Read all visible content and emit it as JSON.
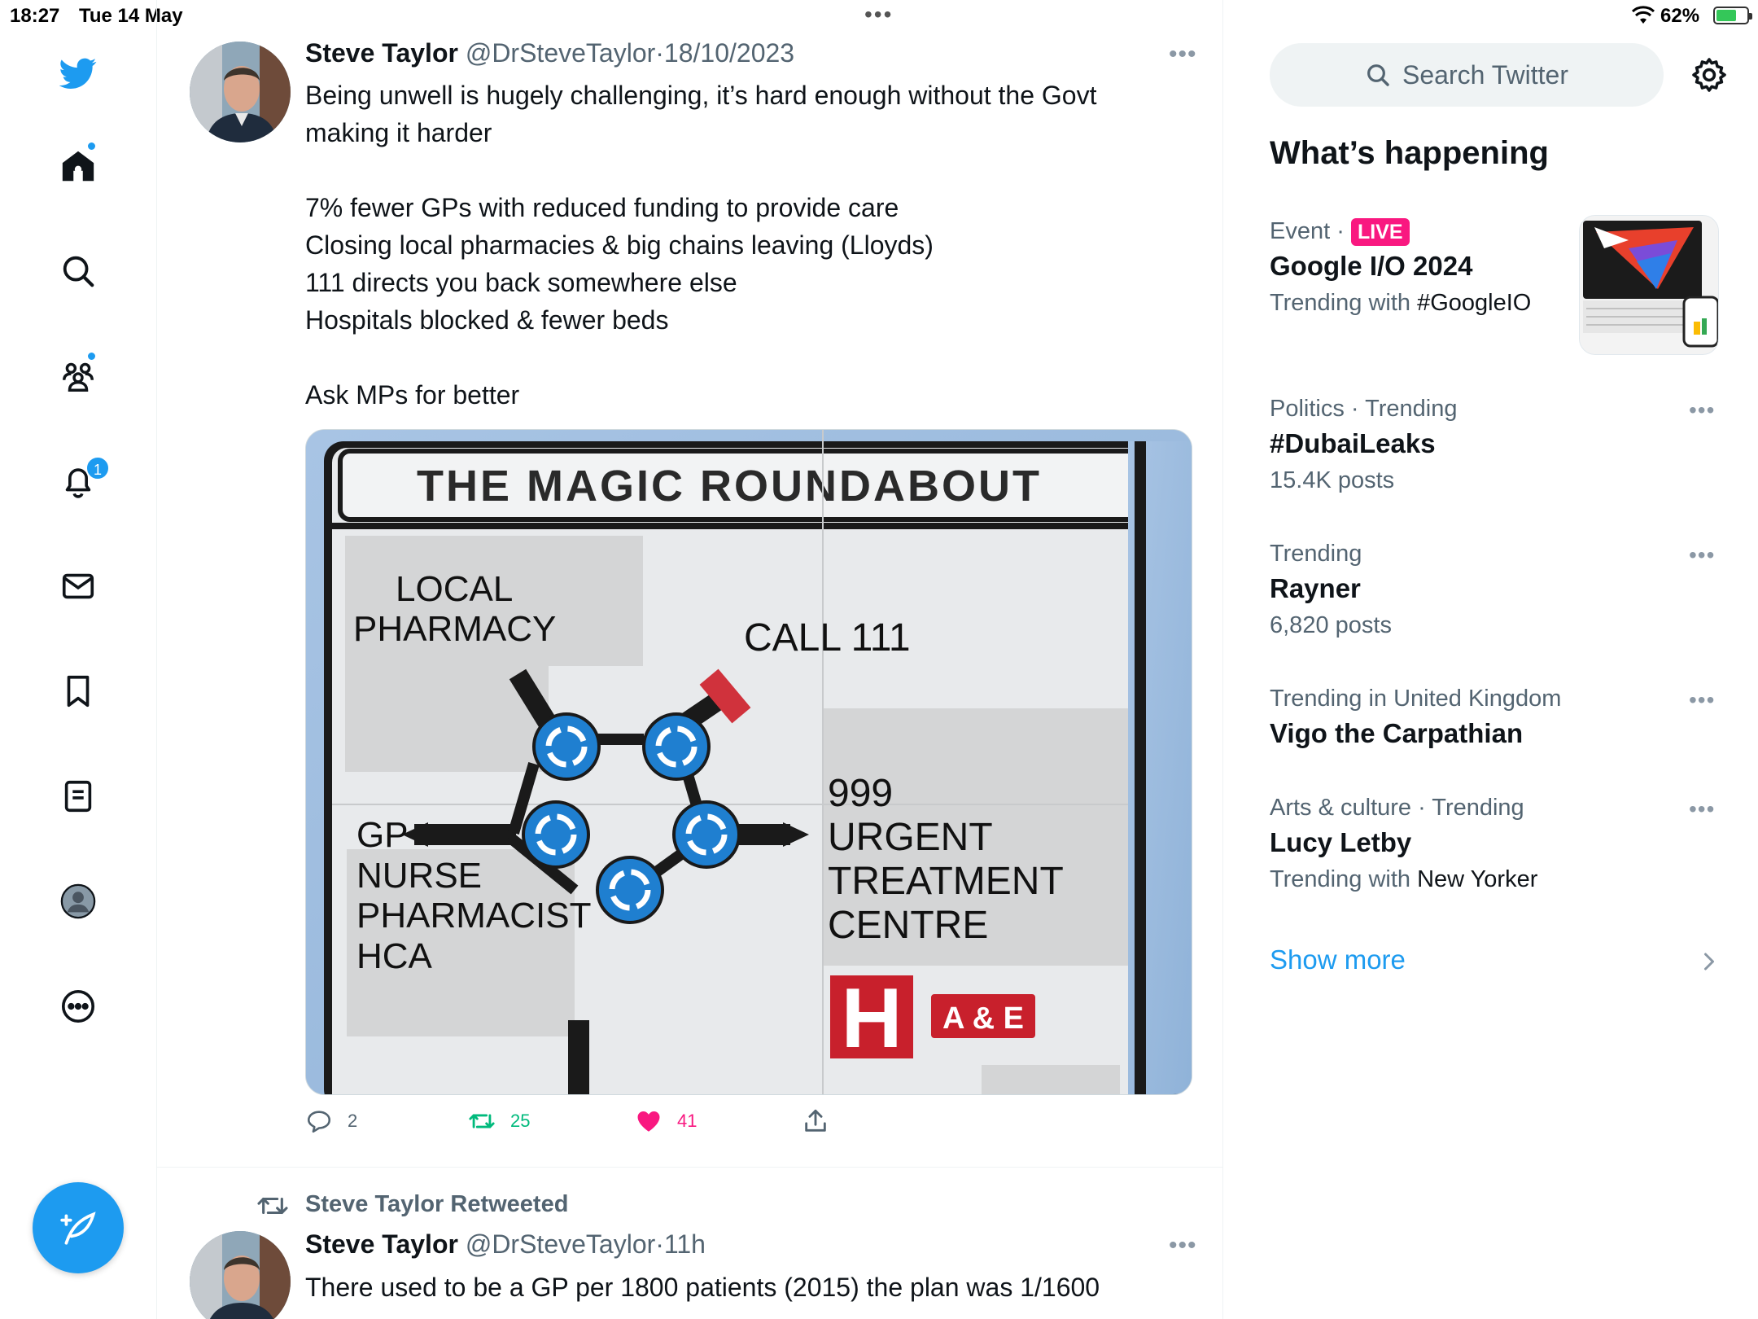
{
  "status_bar": {
    "time": "18:27",
    "date": "Tue 14 May",
    "dots": "•••",
    "battery_percent": "62%",
    "battery_level": 0.62
  },
  "nav": {
    "notifications_count": "1"
  },
  "tweets": [
    {
      "name": "Steve Taylor",
      "handle": "@DrSteveTaylor",
      "separator": "·",
      "date": "18/10/2023",
      "text": "Being unwell is hugely challenging, it’s hard enough without the Govt making it harder\n\n7% fewer GPs with reduced funding to provide care\nClosing local pharmacies & big chains leaving (Lloyds)\n111 directs you back somewhere else\nHospitals blocked & fewer beds\n\nAsk MPs for better",
      "image": {
        "title": "THE MAGIC ROUNDABOUT",
        "label_pharmacy_1": "LOCAL",
        "label_pharmacy_2": "PHARMACY",
        "label_111": "CALL 111",
        "label_left_1": "GP",
        "label_left_2": "NURSE",
        "label_left_3": "PHARMACIST",
        "label_left_4": "HCA",
        "label_right_1": "999",
        "label_right_2": "URGENT",
        "label_right_3": "TREATMENT",
        "label_right_4": "CENTRE",
        "h_letter": "H",
        "ae": "A & E"
      },
      "replies": "2",
      "retweets": "25",
      "likes": "41"
    },
    {
      "retweeted_by": "Steve Taylor Retweeted",
      "name": "Steve Taylor",
      "handle": "@DrSteveTaylor",
      "separator": "·",
      "date": "11h",
      "text": "There used to be a GP per 1800 patients (2015) the plan was 1/1600"
    }
  ],
  "sidebar": {
    "search_placeholder": "Search Twitter",
    "section_title": "What’s happening",
    "trends": [
      {
        "context": "Event ·",
        "live": "LIVE",
        "topic": "Google I/O 2024",
        "meta_prefix": "Trending with ",
        "meta_link": "#GoogleIO"
      },
      {
        "context": "Politics · Trending",
        "topic": "#DubaiLeaks",
        "meta": "15.4K posts"
      },
      {
        "context": "Trending",
        "topic": "Rayner",
        "meta": "6,820 posts"
      },
      {
        "context": "Trending in United Kingdom",
        "topic": "Vigo the Carpathian"
      },
      {
        "context": "Arts & culture · Trending",
        "topic": "Lucy Letby",
        "meta_prefix": "Trending with ",
        "meta_link": "New Yorker"
      }
    ],
    "show_more": "Show more"
  },
  "colors": {
    "accent": "#1d9bf0",
    "like": "#f91880",
    "retweet": "#00ba7c",
    "secondary_text": "#536471"
  }
}
